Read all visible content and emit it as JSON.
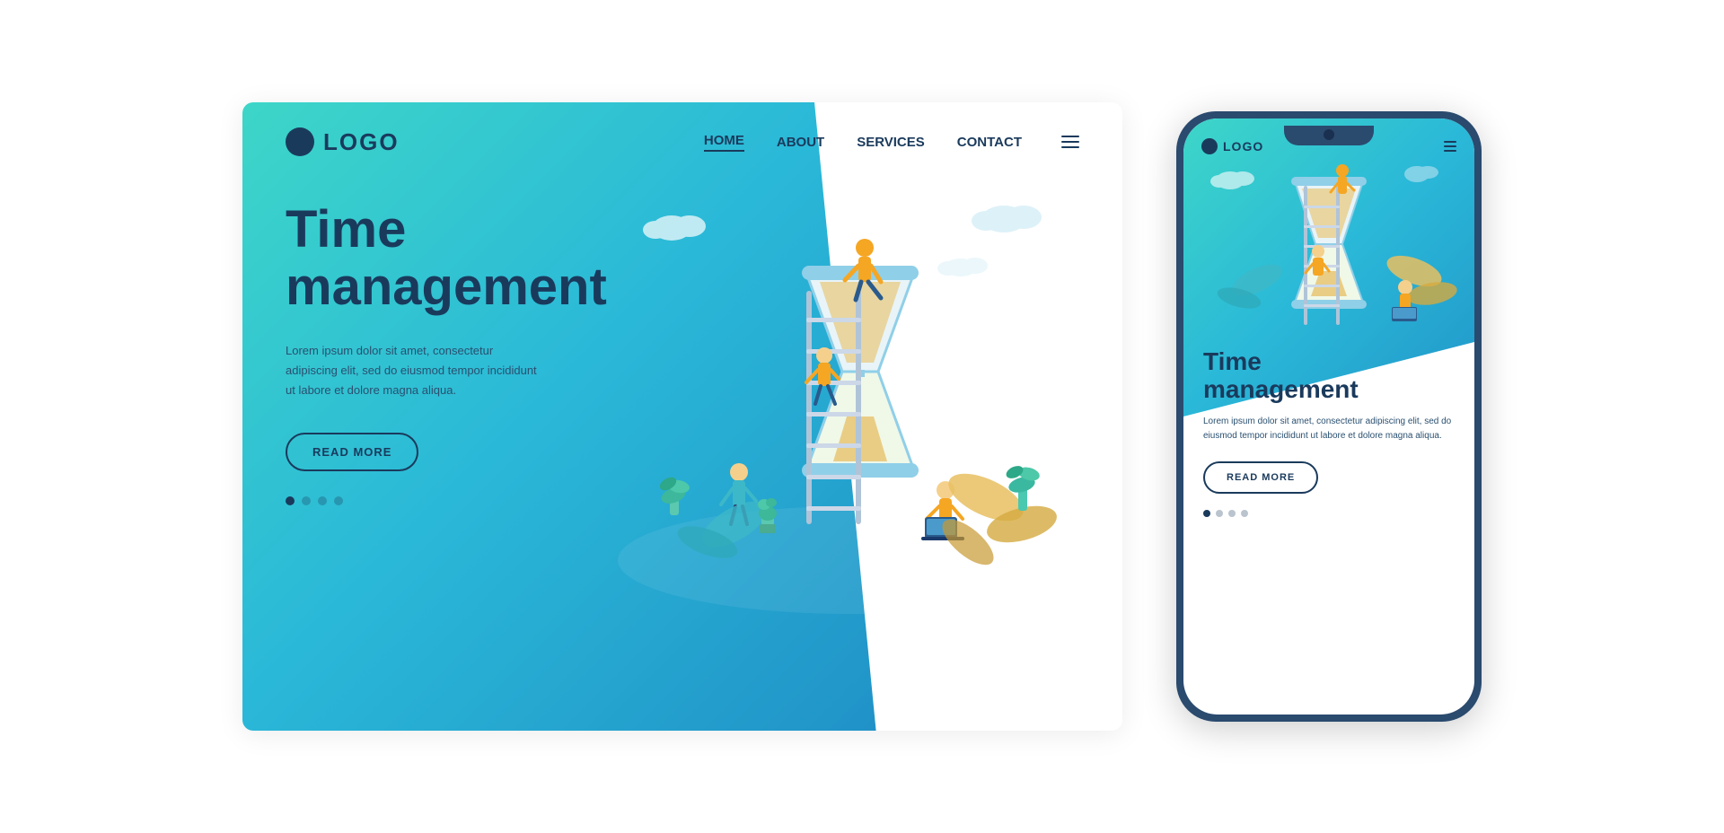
{
  "desktop": {
    "logo": {
      "text": "LOGO"
    },
    "nav": {
      "links": [
        {
          "label": "HOME",
          "active": true
        },
        {
          "label": "ABOUT",
          "active": false
        },
        {
          "label": "SERVICES",
          "active": false
        },
        {
          "label": "CONTACT",
          "active": false
        }
      ]
    },
    "hero": {
      "title_line1": "Time",
      "title_line2": "management",
      "description": "Lorem ipsum dolor sit amet, consectetur adipiscing elit, sed do eiusmod tempor incididunt ut labore et dolore magna aliqua.",
      "cta_label": "READ MORE"
    },
    "pagination": {
      "dots": [
        true,
        false,
        false,
        false
      ]
    }
  },
  "mobile": {
    "logo": {
      "text": "LOGO"
    },
    "hero": {
      "title_line1": "Time",
      "title_line2": "management",
      "description": "Lorem ipsum dolor sit amet, consectetur adipiscing elit, sed do eiusmod tempor incididunt ut labore et dolore magna aliqua.",
      "cta_label": "READ MORE"
    },
    "pagination": {
      "dots": [
        true,
        false,
        false,
        false
      ]
    }
  },
  "colors": {
    "primary": "#1a3a5c",
    "teal_start": "#3dd6c8",
    "teal_end": "#2196c9",
    "accent_yellow": "#f5a623",
    "accent_orange": "#e8793a"
  }
}
